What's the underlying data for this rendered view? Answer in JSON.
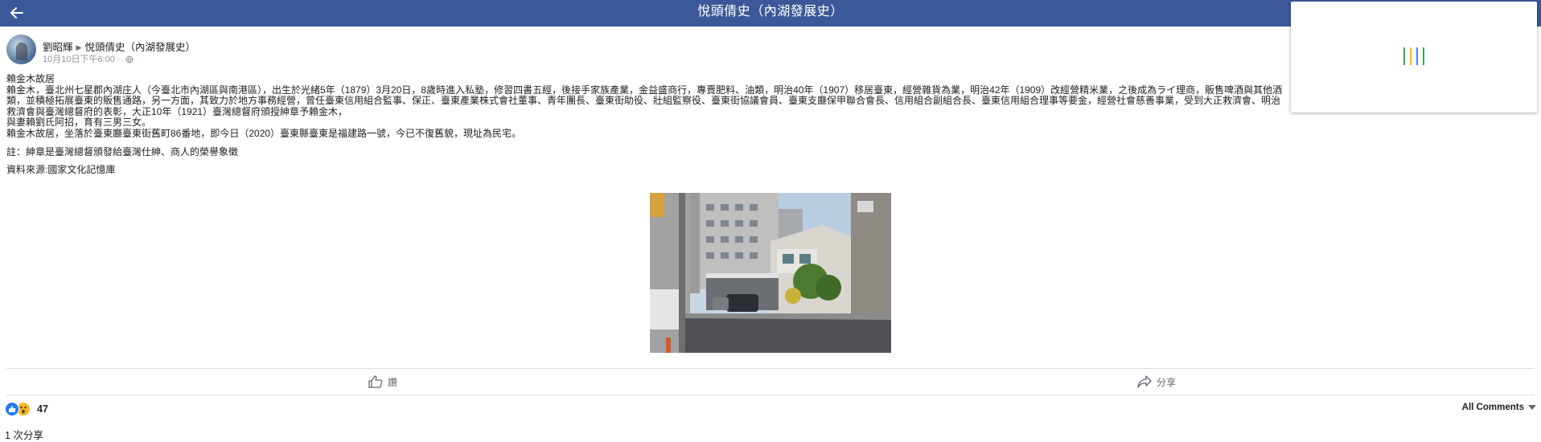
{
  "topbar": {
    "title": "悅頭倩史（內湖發展史）",
    "back_icon": "arrow-left-icon",
    "background": "#3b5998"
  },
  "loading_panel": {
    "spinner_colors": [
      "#34a853",
      "#fbbc05",
      "#4285f4",
      "#34a853"
    ]
  },
  "post": {
    "author": "劉昭輝",
    "group": "悅頭倩史（內湖發展史）",
    "timestamp": "10月10日下午6:00",
    "meta_separator": "·",
    "privacy_icon": "globe-icon",
    "paragraphs": [
      "賴金木故居",
      "賴金木，臺北州七星郡內湖庄人（今臺北市內湖區與南港區），出生於光緒5年（1879）3月20日，8歲時進入私塾，修習四書五經，後接手家族產業，金益盛商行，專賣肥料、油類，明治40年（1907）移居臺東，經營雜貨為業，明治42年（1909）改經營精米業，之後成為ライ理商，販售啤酒與其他酒類，並積極拓展臺東的販售通路，另一方面，其致力於地方事務經營，曾任臺東信用組合監事、保正、臺東產業株式會社董事、青年團長、臺東街助役、壯組監察役、臺東街協議會員、臺東支廳保甲聯合會長、信用組合副組合長、臺東信用組合理事等要金，經營社會慈善事業，受到大正救濟會、明治救濟會與臺灣總督府的表彰，大正10年（1921）臺灣總督府頒授紳章予賴金木，",
      "與妻賴劉氏阿招，育有三男三女。",
      "賴金木故居，坐落於臺東廳臺東街舊町86番地，即今日（2020）臺東縣臺東是福建路一號，今已不復舊貌，現址為民宅。",
      "註：紳章是臺灣總督頒發給臺灣仕紳、商人的榮譽象徵",
      "資料來源:國家文化記憶庫"
    ],
    "photo_alt": "street-photo"
  },
  "actions": {
    "like_label": "讚",
    "share_label": "分享",
    "like_icon": "thumbs-up-icon",
    "share_icon": "share-arrow-icon"
  },
  "reactions": {
    "count": "47",
    "like_color": "#2078f4",
    "wow_color": "#f7b928"
  },
  "comments": {
    "filter_label": "All Comments"
  },
  "shares": {
    "label": "1 次分享"
  }
}
